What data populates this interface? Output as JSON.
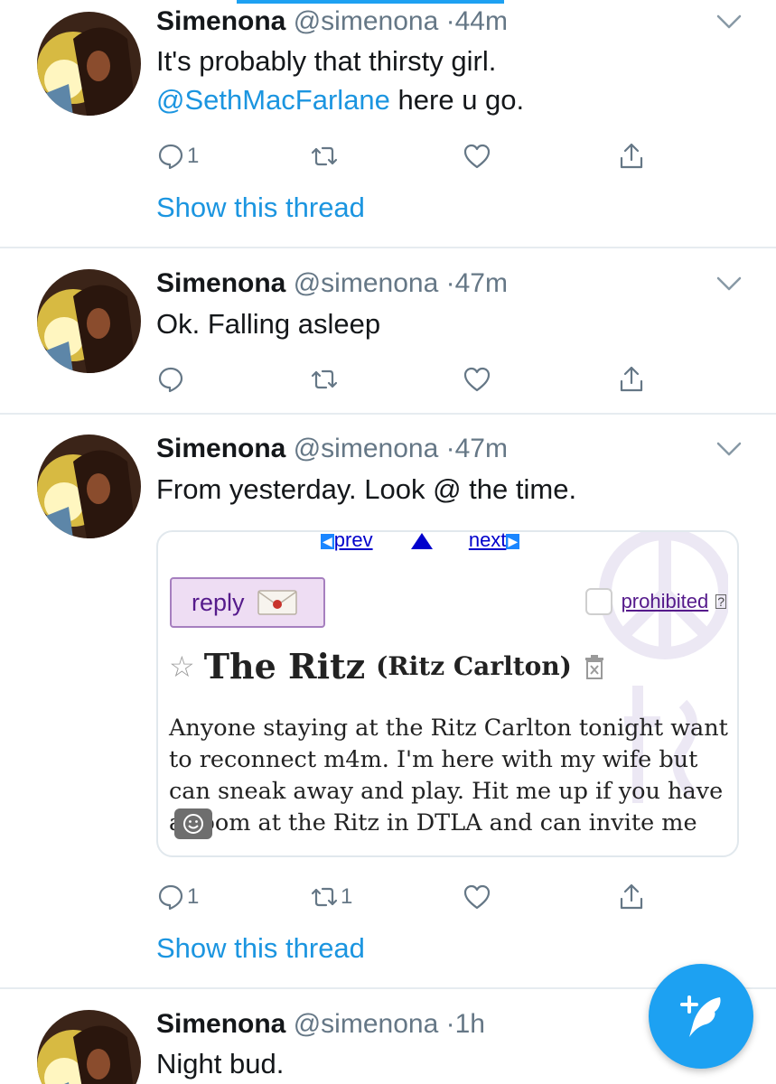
{
  "tweets": [
    {
      "name": "Simenona",
      "handle": "@simenona",
      "separator": "·",
      "time": "44m",
      "text_plain": "It's probably that thirsty girl.",
      "mention": "@SethMacFarlane",
      "text_after_mention": "here u go.",
      "reply_count": "1",
      "retweet_count": "",
      "show_thread": "Show this thread"
    },
    {
      "name": "Simenona",
      "handle": "@simenona",
      "separator": "·",
      "time": "47m",
      "text_plain": "Ok. Falling asleep",
      "reply_count": "",
      "retweet_count": ""
    },
    {
      "name": "Simenona",
      "handle": "@simenona",
      "separator": "·",
      "time": "47m",
      "text_plain": "From yesterday. Look @ the time.",
      "reply_count": "1",
      "retweet_count": "1",
      "show_thread": "Show this thread",
      "embedded": {
        "prev_label": "prev",
        "next_label": "next",
        "reply_label": "reply",
        "prohibited_label": "prohibited",
        "help_label": "?",
        "title": "The Ritz",
        "subtitle": "(Ritz Carlton)",
        "body": "Anyone staying at the Ritz Carlton tonight want to reconnect m4m. I'm here with my wife but can sneak away and play. Hit me up if you have a room at the Ritz in DTLA and can invite me"
      }
    },
    {
      "name": "Simenona",
      "handle": "@simenona",
      "separator": "·",
      "time": "1h",
      "text_plain": "Night bud."
    }
  ],
  "icons": {
    "reply": "reply-icon",
    "retweet": "retweet-icon",
    "like": "heart-icon",
    "share": "share-icon",
    "caret": "chevron-down-icon",
    "compose": "compose-tweet-icon"
  },
  "colors": {
    "accent": "#1da1f2",
    "link": "#1b95e0",
    "secondary_text": "#657786",
    "divider": "#e6ecf0"
  }
}
